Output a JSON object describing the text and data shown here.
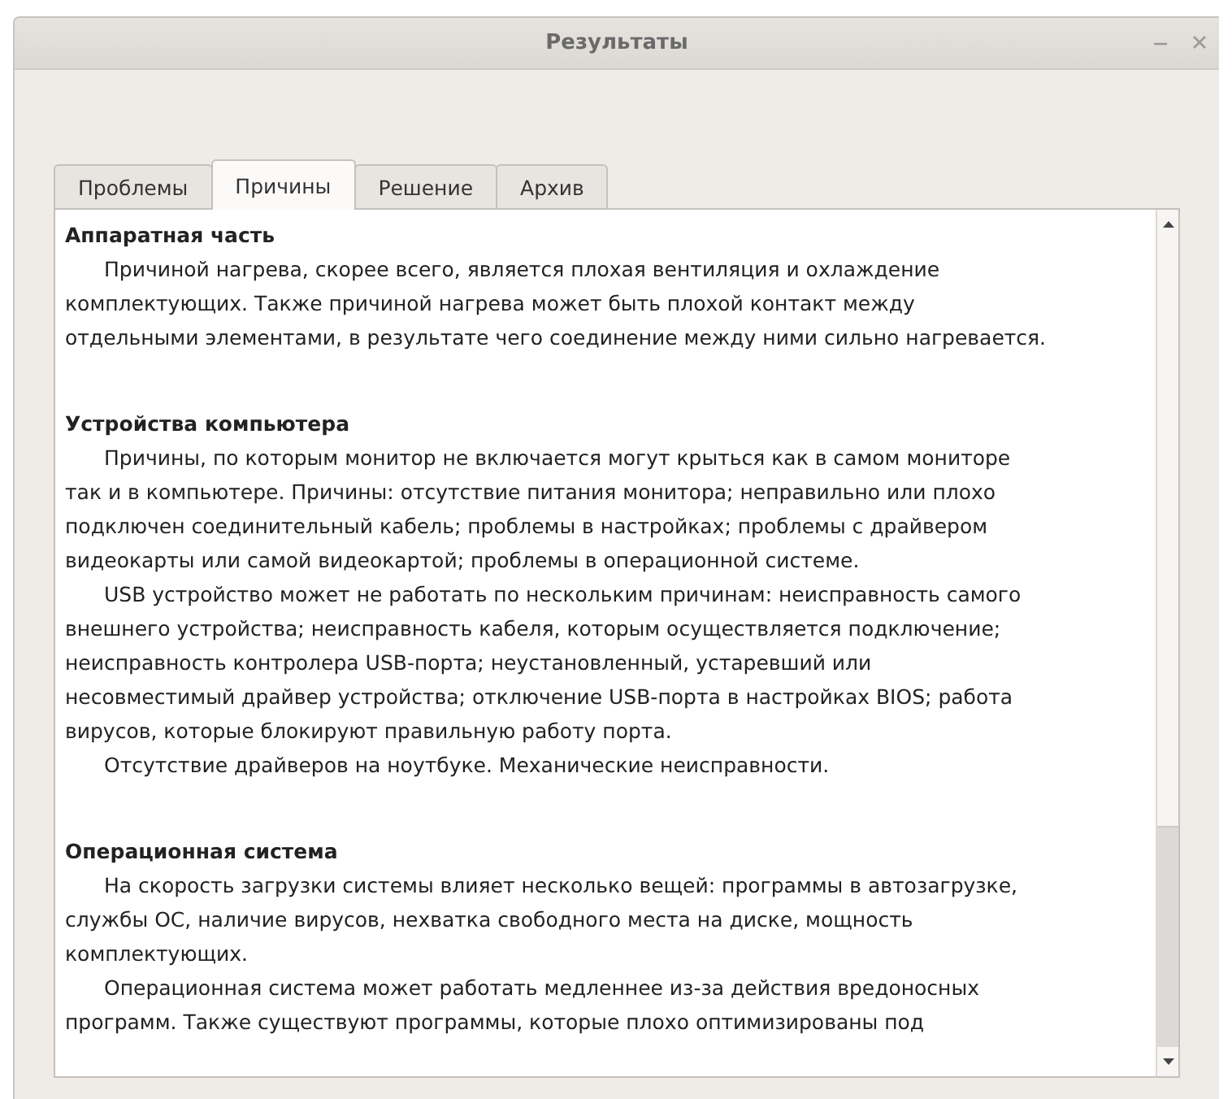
{
  "window": {
    "title": "Результаты"
  },
  "tabs": [
    {
      "label": "Проблемы",
      "selected": false
    },
    {
      "label": "Причины",
      "selected": true
    },
    {
      "label": "Решение",
      "selected": false
    },
    {
      "label": "Архив",
      "selected": false
    }
  ],
  "sections": [
    {
      "heading": "Аппаратная часть",
      "paragraphs": [
        [
          "Причиной нагрева, скорее всего, является плохая вентиляция и охлаждение",
          "комплектующих. Также причиной нагрева может быть плохой контакт между",
          "отдельными элементами, в результате чего соединение между ними сильно нагревается."
        ]
      ]
    },
    {
      "heading": "Устройства компьютера",
      "paragraphs": [
        [
          "Причины, по которым монитор не включается могут крыться как в самом мониторе",
          "так и в компьютере. Причины: отсутствие питания монитора; неправильно или плохо",
          "подключен соединительный кабель; проблемы в настройках; проблемы с драйвером",
          "видеокарты или самой видеокартой; проблемы в операционной системе."
        ],
        [
          "USB устройство может не работать по нескольким причинам: неисправность самого",
          "внешнего устройства; неисправность кабеля, которым осуществляется подключение;",
          "неисправность контролера USB-порта; неустановленный, устаревший или",
          "несовместимый драйвер устройства; отключение USB-порта в настройках BIOS; работа",
          "вирусов, которые блокируют правильную работу порта."
        ],
        [
          "Отсутствие драйверов на ноутбуке. Механические неисправности."
        ]
      ]
    },
    {
      "heading": "Операционная система",
      "paragraphs": [
        [
          "На скорость загрузки системы влияет несколько вещей: программы в автозагрузке,",
          "службы ОС, наличие вирусов, нехватка свободного места на диске, мощность",
          "комплектующих."
        ],
        [
          "Операционная система может работать медленнее из-за действия вредоносных",
          "программ. Также существуют программы, которые плохо оптимизированы под"
        ]
      ]
    }
  ]
}
